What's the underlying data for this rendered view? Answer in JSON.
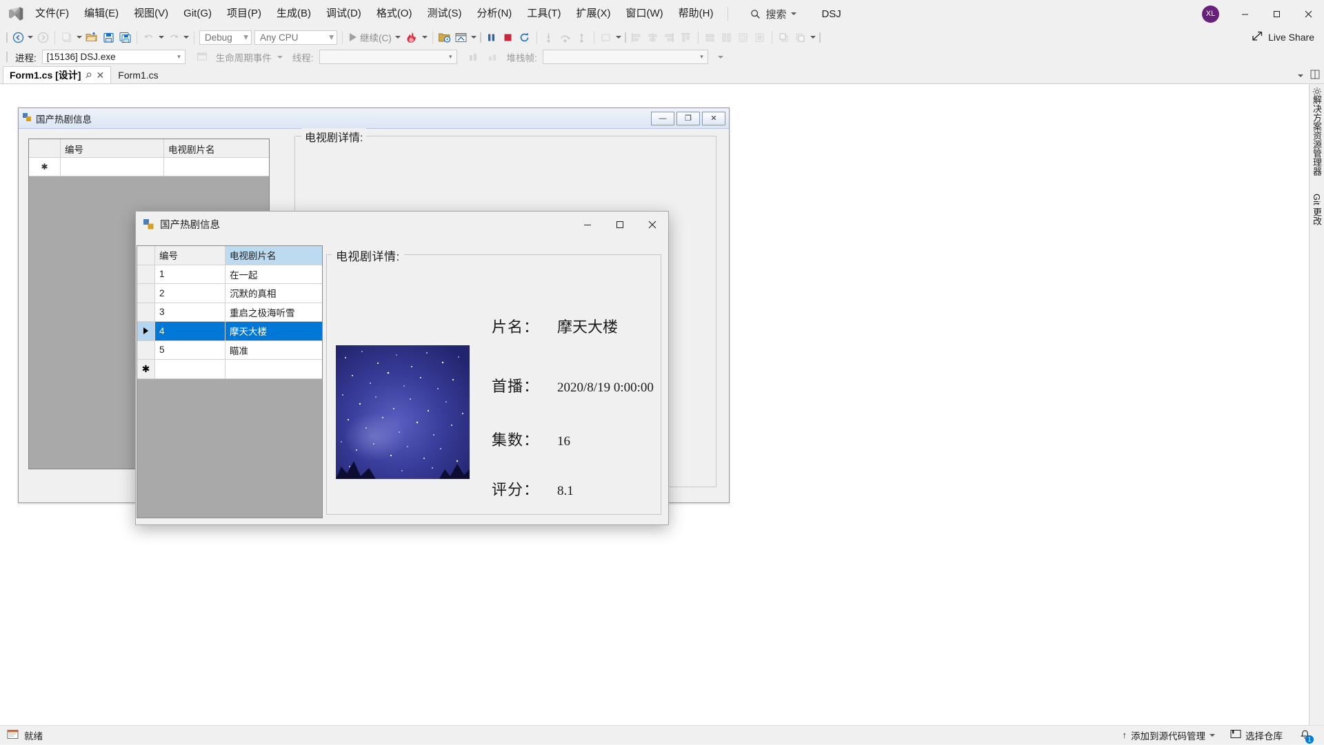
{
  "app": {
    "title": "DSJ",
    "avatar_initials": "XL",
    "live_share": "Live Share"
  },
  "menu": {
    "items": [
      {
        "label": "文件(F)",
        "name": "menu-file"
      },
      {
        "label": "编辑(E)",
        "name": "menu-edit"
      },
      {
        "label": "视图(V)",
        "name": "menu-view"
      },
      {
        "label": "Git(G)",
        "name": "menu-git"
      },
      {
        "label": "项目(P)",
        "name": "menu-project"
      },
      {
        "label": "生成(B)",
        "name": "menu-build"
      },
      {
        "label": "调试(D)",
        "name": "menu-debug"
      },
      {
        "label": "格式(O)",
        "name": "menu-format"
      },
      {
        "label": "测试(S)",
        "name": "menu-test"
      },
      {
        "label": "分析(N)",
        "name": "menu-analyze"
      },
      {
        "label": "工具(T)",
        "name": "menu-tools"
      },
      {
        "label": "扩展(X)",
        "name": "menu-extensions"
      },
      {
        "label": "窗口(W)",
        "name": "menu-window"
      },
      {
        "label": "帮助(H)",
        "name": "menu-help"
      }
    ]
  },
  "search": {
    "label": "搜索",
    "placeholder": "搜索"
  },
  "toolbar": {
    "config": "Debug",
    "platform": "Any CPU",
    "continue_label": "继续(C)"
  },
  "processbar": {
    "process_label": "进程:",
    "process_value": "[15136] DSJ.exe",
    "lifecycle_label": "生命周期事件",
    "thread_label": "线程:",
    "thread_value": "",
    "stackframe_label": "堆栈帧:",
    "stackframe_value": ""
  },
  "tabs": [
    {
      "label": "Form1.cs [设计]",
      "active": true,
      "name": "tab-form1-designer"
    },
    {
      "label": "Form1.cs",
      "active": false,
      "name": "tab-form1-code"
    }
  ],
  "designer_form": {
    "title": "国产热剧信息",
    "grid_headers": [
      "",
      "编号",
      "电视剧片名"
    ],
    "group_caption": "电视剧详情:"
  },
  "app_window": {
    "title": "国产热剧信息",
    "grid": {
      "headers": {
        "select": "",
        "id": "编号",
        "name": "电视剧片名"
      },
      "rows": [
        {
          "id": "1",
          "name": "在一起",
          "selected": false,
          "marker": ""
        },
        {
          "id": "2",
          "name": "沉默的真相",
          "selected": false,
          "marker": ""
        },
        {
          "id": "3",
          "name": "重启之极海听雪",
          "selected": false,
          "marker": ""
        },
        {
          "id": "4",
          "name": "摩天大楼",
          "selected": true,
          "marker": "arrow"
        },
        {
          "id": "5",
          "name": "瞄准",
          "selected": false,
          "marker": ""
        },
        {
          "id": "",
          "name": "",
          "selected": false,
          "marker": "star"
        }
      ]
    },
    "details": {
      "caption": "电视剧详情:",
      "fields": [
        {
          "label": "片名：",
          "value": "摩天大楼",
          "name": "detail-title"
        },
        {
          "label": "首播：",
          "value": "2020/8/19 0:00:00",
          "name": "detail-premiere"
        },
        {
          "label": "集数：",
          "value": "16",
          "name": "detail-episodes"
        },
        {
          "label": "评分：",
          "value": "8.1",
          "name": "detail-rating"
        }
      ]
    }
  },
  "right_dock": {
    "items": [
      {
        "label": "解决方案资源管理器",
        "name": "dock-solution-explorer"
      },
      {
        "label": "Git 更改",
        "name": "dock-git-changes"
      }
    ]
  },
  "statusbar": {
    "ready": "就绪",
    "add_to_source_control": "添加到源代码管理",
    "select_repository": "选择仓库",
    "notification_count": "1"
  },
  "colors": {
    "accent": "#0078d7",
    "header_highlight": "#bddbf0",
    "chrome": "#f0f0f0",
    "poster_bg": "#2b2f86"
  }
}
